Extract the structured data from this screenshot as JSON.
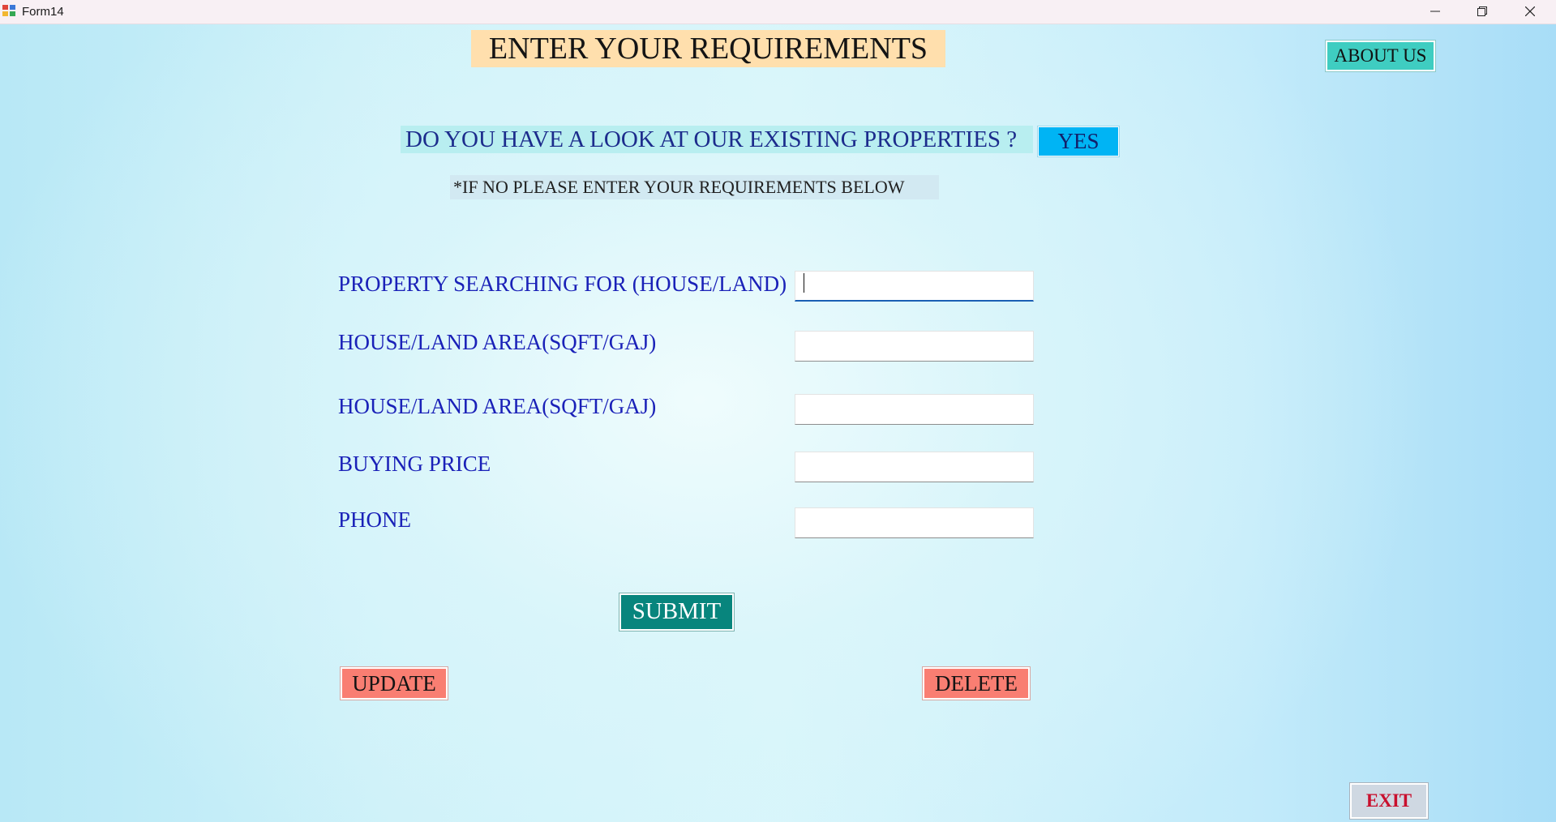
{
  "window": {
    "title": "Form14",
    "controls": [
      "minimize-icon",
      "restore-icon",
      "close-icon"
    ]
  },
  "heading": "ENTER YOUR REQUIREMENTS",
  "about_button": "ABOUT US",
  "question": "DO YOU HAVE A LOOK AT OUR EXISTING PROPERTIES ?",
  "yes_button": "YES",
  "note": "*IF NO PLEASE ENTER YOUR REQUIREMENTS BELOW",
  "fields": [
    {
      "label": "PROPERTY SEARCHING FOR (HOUSE/LAND)",
      "value": "",
      "focused": true
    },
    {
      "label": "HOUSE/LAND AREA(SQFT/GAJ)",
      "value": ""
    },
    {
      "label": "HOUSE/LAND AREA(SQFT/GAJ)",
      "value": ""
    },
    {
      "label": "BUYING PRICE",
      "value": ""
    },
    {
      "label": "PHONE",
      "value": ""
    }
  ],
  "buttons": {
    "submit": "SUBMIT",
    "update": "UPDATE",
    "delete": "DELETE",
    "exit": "EXIT"
  },
  "colors": {
    "heading_bg": "#ffdfad",
    "yes_bg": "#00b4f4",
    "about_bg": "#3fcdc1",
    "submit_bg": "#08857d",
    "update_delete_bg": "#f97e72",
    "exit_text": "#c8102e",
    "label_text": "#1a21b8"
  }
}
